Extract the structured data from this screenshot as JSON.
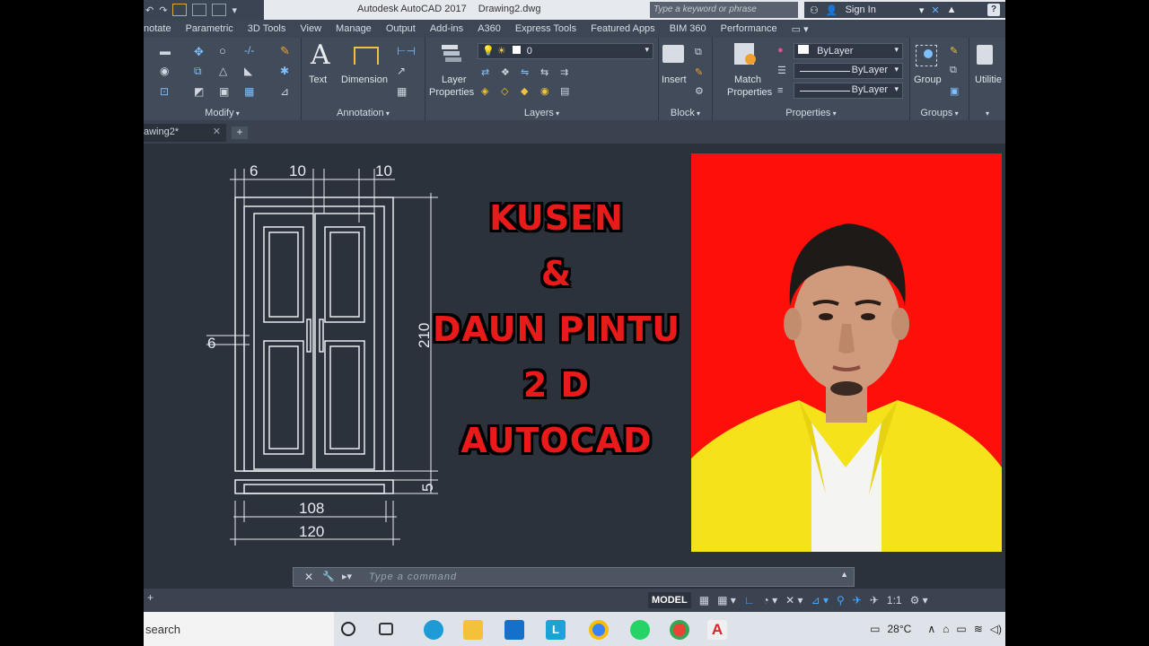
{
  "titlebar": {
    "app_name": "Autodesk AutoCAD 2017",
    "file_name": "Drawing2.dwg",
    "search_placeholder": "Type a keyword or phrase",
    "sign_in": "Sign In",
    "help_label": "?"
  },
  "ribbon_tabs": [
    "notate",
    "Parametric",
    "3D Tools",
    "View",
    "Manage",
    "Output",
    "Add-ins",
    "A360",
    "Express Tools",
    "Featured Apps",
    "BIM 360",
    "Performance"
  ],
  "ribbon": {
    "modify_title": "Modify",
    "annotation_title": "Annotation",
    "text_label": "Text",
    "dimension_label": "Dimension",
    "layers_title": "Layers",
    "layer_properties_label_1": "Layer",
    "layer_properties_label_2": "Properties",
    "layer_value": "0",
    "block_title": "Block",
    "insert_label": "Insert",
    "match_label_1": "Match",
    "match_label_2": "Properties",
    "properties_title": "Properties",
    "color_value": "ByLayer",
    "linetype_value": "ByLayer",
    "lineweight_value": "ByLayer",
    "group_label": "Group",
    "groups_title": "Groups",
    "utilities_label": "Utilitie"
  },
  "file_tab": {
    "name": "awing2*",
    "close": "✕",
    "new_tab": "+"
  },
  "drawing": {
    "dim_top_left": "6",
    "dim_top_mid": "10",
    "dim_top_right": "10",
    "dim_side": "6",
    "dim_height": "210",
    "dim_sill": "5",
    "dim_inner_width": "108",
    "dim_outer_width": "120"
  },
  "headline": {
    "line1": "KUSEN",
    "line2": "&",
    "line3": "DAUN PINTU",
    "line4": "2 D",
    "line5": "AUTOCAD"
  },
  "command": {
    "placeholder": "Type a command"
  },
  "status": {
    "model": "MODEL",
    "scale": "1:1"
  },
  "taskbar": {
    "search": "search",
    "temperature": "28°C"
  },
  "colors": {
    "canvas_bg": "#2b323b",
    "headline_red": "#e81a1a",
    "photo_red": "#ff0f0a",
    "jacket_yellow": "#f5e21a"
  }
}
